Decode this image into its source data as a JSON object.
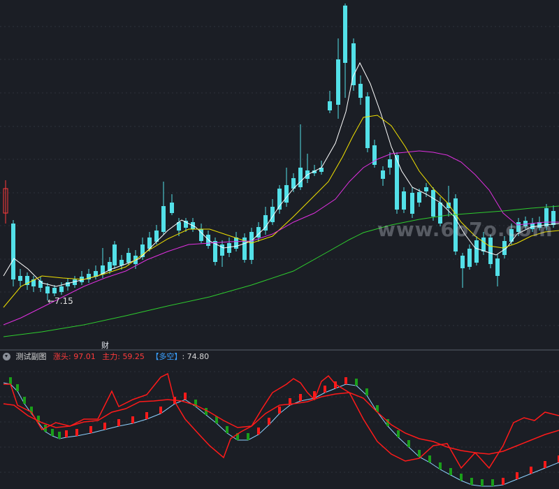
{
  "main": {
    "annotation": "←7.15",
    "fin_badge": "财",
    "watermark": "www.6o7o.com"
  },
  "sub": {
    "title": "测试副图",
    "series": [
      {
        "label": "涨头:",
        "value": "97.01",
        "color": "#ff3b3b"
      },
      {
        "label": "主力:",
        "value": "59.25",
        "color": "#ff3b3b"
      },
      {
        "label": "【多空】",
        "value": ": 74.80",
        "color": "#3aa0ff"
      }
    ]
  },
  "colors": {
    "background": "#1b1e25",
    "up": "#ff3b3b",
    "down": "#53e0e8",
    "ma5": "#ffffff",
    "ma10": "#f2e200",
    "ma20": "#e030e0",
    "ma60": "#2ecc2e",
    "sub_red": "#ff1a1a",
    "sub_green": "#1a9e1a"
  }
}
